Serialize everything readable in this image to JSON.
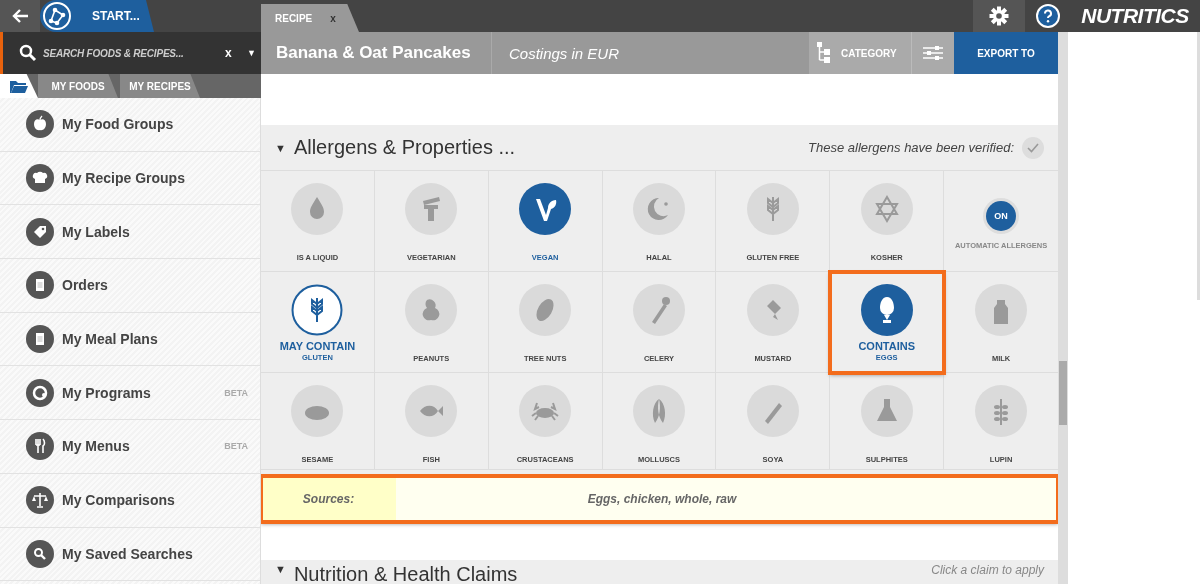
{
  "top_bar": {
    "start_label": "START...",
    "tabs": [
      {
        "label": "RECIPE",
        "close": "x",
        "selected": true
      }
    ],
    "logo": "NUTRITICS"
  },
  "search": {
    "placeholder": "SEARCH FOODS & RECIPES...",
    "clear": "x",
    "dropdown": "▼"
  },
  "panel_tabs": [
    {
      "label": "MY FOODS",
      "selected": false
    },
    {
      "label": "MY RECIPES",
      "selected": false
    }
  ],
  "sidebar": {
    "items": [
      {
        "label": "My Food Groups"
      },
      {
        "label": "My Recipe Groups"
      },
      {
        "label": "My Labels"
      },
      {
        "label": "Orders"
      },
      {
        "label": "My Meal Plans"
      },
      {
        "label": "My Programs",
        "badge": "BETA"
      },
      {
        "label": "My Menus",
        "badge": "BETA"
      },
      {
        "label": "My Comparisons"
      },
      {
        "label": "My Saved Searches"
      }
    ]
  },
  "recipe_header": {
    "title": "Banana & Oat Pancakes",
    "costings": "Costings in EUR",
    "category_button": "CATEGORY",
    "export_button": "EXPORT TO"
  },
  "allergens": {
    "toggle_icon": "▼",
    "title": "Allergens & Properties ...",
    "verified_note": "These allergens have been verified:",
    "items": [
      {
        "kind": "property",
        "label": "IS A LIQUID",
        "selected": false
      },
      {
        "kind": "property",
        "label": "VEGETARIAN",
        "selected": false
      },
      {
        "kind": "property",
        "label": "VEGAN",
        "selected": true
      },
      {
        "kind": "property",
        "label": "HALAL",
        "selected": false
      },
      {
        "kind": "property",
        "label": "GLUTEN FREE",
        "selected": false
      },
      {
        "kind": "property",
        "label": "KOSHER",
        "selected": false
      },
      {
        "kind": "toggle",
        "label": "AUTOMATIC ALLERGENS",
        "value": "ON",
        "on": true
      },
      {
        "kind": "allergen",
        "label": "GLUTEN",
        "may_contain": true,
        "contains": false,
        "status_label": "MAY CONTAIN"
      },
      {
        "kind": "allergen",
        "label": "PEANUTS",
        "may_contain": false,
        "contains": false
      },
      {
        "kind": "allergen",
        "label": "TREE NUTS",
        "may_contain": false,
        "contains": false
      },
      {
        "kind": "allergen",
        "label": "CELERY",
        "may_contain": false,
        "contains": false
      },
      {
        "kind": "allergen",
        "label": "MUSTARD",
        "may_contain": false,
        "contains": false
      },
      {
        "kind": "allergen",
        "label": "EGGS",
        "may_contain": false,
        "contains": true,
        "status_label": "CONTAINS",
        "highlighted": true
      },
      {
        "kind": "allergen",
        "label": "MILK",
        "may_contain": false,
        "contains": false
      },
      {
        "kind": "allergen",
        "label": "SESAME",
        "may_contain": false,
        "contains": false
      },
      {
        "kind": "allergen",
        "label": "FISH",
        "may_contain": false,
        "contains": false
      },
      {
        "kind": "allergen",
        "label": "CRUSTACEANS",
        "may_contain": false,
        "contains": false
      },
      {
        "kind": "allergen",
        "label": "MOLLUSCS",
        "may_contain": false,
        "contains": false
      },
      {
        "kind": "allergen",
        "label": "SOYA",
        "may_contain": false,
        "contains": false
      },
      {
        "kind": "allergen",
        "label": "SULPHITES",
        "may_contain": false,
        "contains": false
      },
      {
        "kind": "allergen",
        "label": "LUPIN",
        "may_contain": false,
        "contains": false
      }
    ],
    "sources": {
      "label": "Sources:",
      "value": "Eggs, chicken, whole, raw",
      "highlighted": true
    }
  },
  "claims": {
    "toggle_icon": "▼",
    "title": "Nutrition & Health Claims",
    "hint": "Click a claim to apply"
  }
}
